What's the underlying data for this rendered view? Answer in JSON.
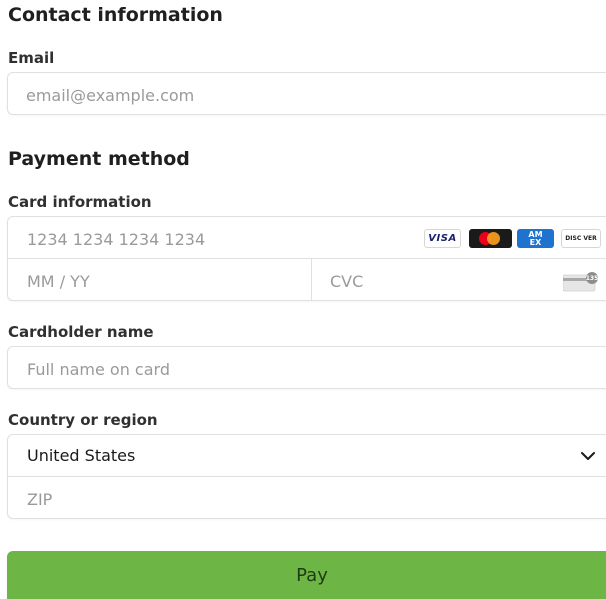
{
  "contact": {
    "heading": "Contact information",
    "email_label": "Email",
    "email_placeholder": "email@example.com",
    "email_value": ""
  },
  "payment": {
    "heading": "Payment method",
    "card_label": "Card information",
    "card_number_placeholder": "1234 1234 1234 1234",
    "expiry_placeholder": "MM / YY",
    "cvc_placeholder": "CVC",
    "cvc_icon_digits": "135",
    "brands": {
      "visa": "VISA",
      "amex_line1": "AM",
      "amex_line2": "EX",
      "discover": "DISC VER"
    }
  },
  "cardholder": {
    "label": "Cardholder name",
    "placeholder": "Full name on card"
  },
  "country": {
    "label": "Country or region",
    "selected": "United States",
    "zip_placeholder": "ZIP"
  },
  "actions": {
    "pay_label": "Pay"
  },
  "colors": {
    "pay_button": "#6db544",
    "border": "#e0e0e0",
    "placeholder": "#9a9a9a"
  },
  "icons": {
    "card_brands": [
      "visa-icon",
      "mastercard-icon",
      "amex-icon",
      "discover-icon"
    ],
    "cvc": "cvc-card-icon",
    "select": "chevron-down-icon"
  }
}
